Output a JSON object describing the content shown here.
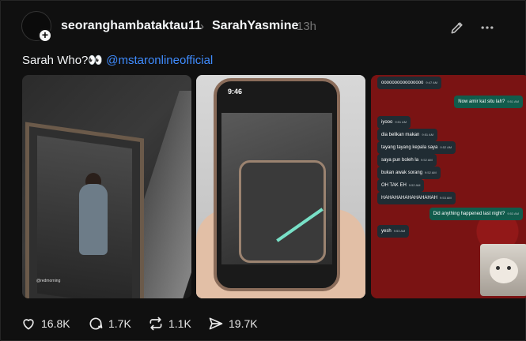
{
  "post": {
    "author": "seoranghambataktau11",
    "co_author": "SarahYasmine",
    "time": "13h",
    "caption_text": "Sarah Who?👀",
    "caption_mention": "@mstaronlineofficial"
  },
  "media": {
    "photo1_tag": "@redmorning",
    "photo2_status_time": "9:46",
    "chat": [
      {
        "text": "oooooooooooooooo",
        "time": "9:47 AM",
        "side": "in"
      },
      {
        "text": "Now amir kat situ lah?",
        "time": "9:51 AM",
        "side": "out"
      },
      {
        "text": "iyooo",
        "time": "9:51 AM",
        "side": "in"
      },
      {
        "text": "dia belikan makan",
        "time": "9:51 AM",
        "side": "in"
      },
      {
        "text": "tayang tayang kepala saya",
        "time": "9:52 AM",
        "side": "in"
      },
      {
        "text": "saya pun boleh la",
        "time": "9:52 AM",
        "side": "in"
      },
      {
        "text": "bukan awak sorang",
        "time": "9:52 AM",
        "side": "in"
      },
      {
        "text": "OH TAK EH",
        "time": "9:52 AM",
        "side": "in"
      },
      {
        "text": "HAHAHAHAHAHAHAHAH",
        "time": "9:53 AM",
        "side": "in"
      },
      {
        "text": "Did anything happened last night?",
        "time": "9:53 AM",
        "side": "out"
      },
      {
        "text": "yesh",
        "time": "9:53 AM",
        "side": "in"
      }
    ]
  },
  "actions": {
    "likes": "16.8K",
    "replies": "1.7K",
    "reposts": "1.1K",
    "shares": "19.7K"
  },
  "colors": {
    "background": "#101010",
    "mention": "#3f8cff",
    "chat_bg": "#7a1313"
  }
}
